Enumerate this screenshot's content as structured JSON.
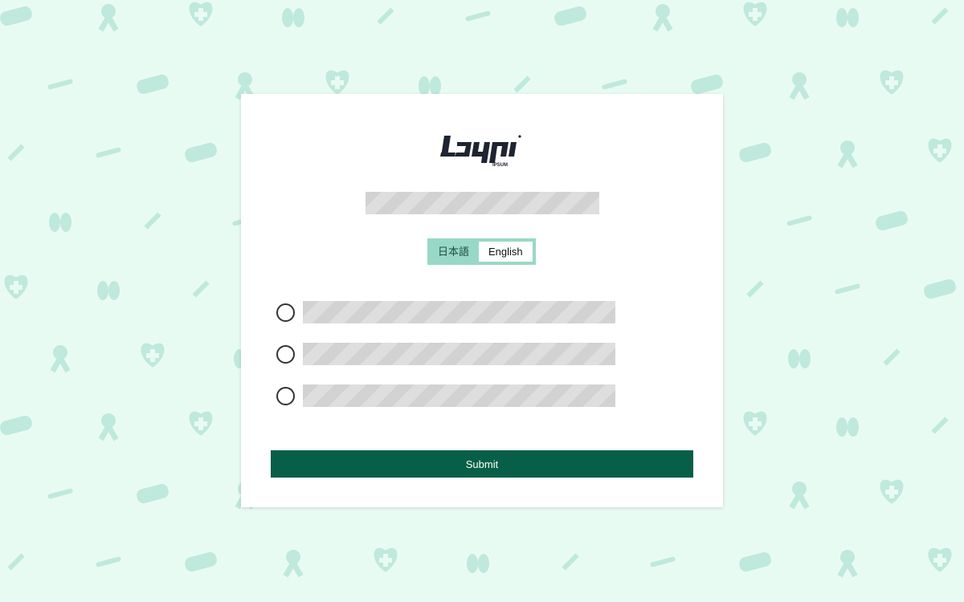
{
  "brand": {
    "logo_text": "Logo",
    "logo_subtext": "IPSUM"
  },
  "language": {
    "options": [
      "日本語",
      "English"
    ],
    "selected": "English"
  },
  "options_count_note": null,
  "form": {
    "submit_label": "Submit"
  },
  "colors": {
    "background": "#e8fbf3",
    "pattern": "#bfe9dc",
    "accent": "#98d8c6",
    "submit": "#085f48"
  },
  "icons": [
    "mask-icon",
    "ribbon-icon",
    "heart-cross-icon",
    "lungs-icon",
    "syringe-icon",
    "thermometer-icon"
  ]
}
